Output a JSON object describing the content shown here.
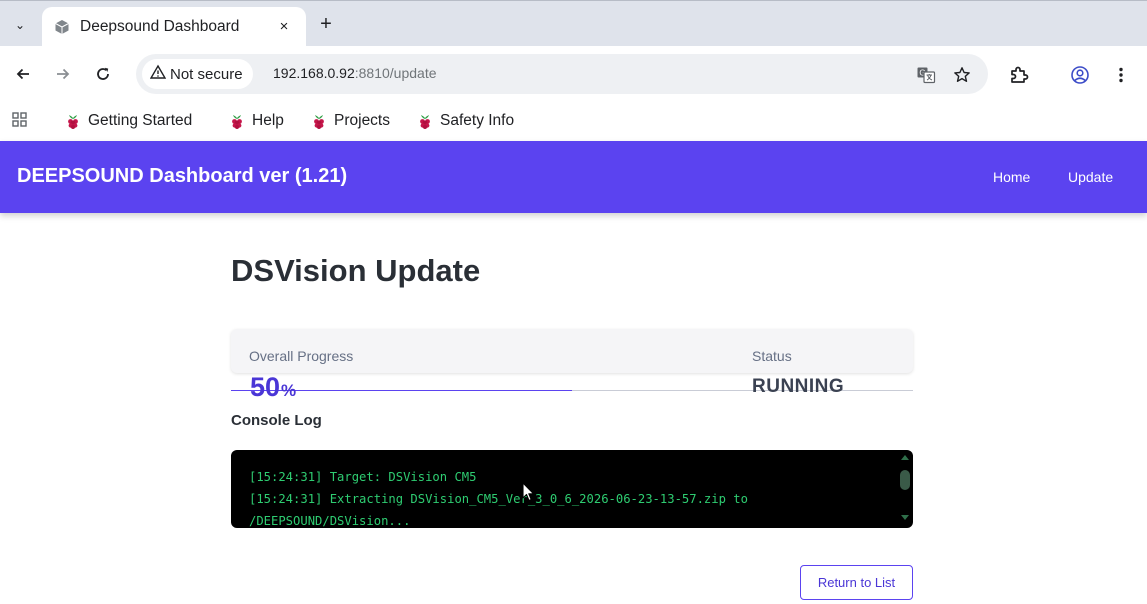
{
  "browser": {
    "tab": {
      "title": "Deepsound Dashboard",
      "close_glyph": "×",
      "favicon": "cube-icon"
    },
    "new_tab_glyph": "+",
    "tab_menu_glyph": "⌄",
    "security_label": "Not secure",
    "url_host": "192.168.0.92",
    "url_rest": ":8810/update",
    "bookmarks": [
      {
        "label": "Getting Started",
        "icon": "raspberry-icon"
      },
      {
        "label": "Help",
        "icon": "raspberry-icon"
      },
      {
        "label": "Projects",
        "icon": "raspberry-icon"
      },
      {
        "label": "Safety Info",
        "icon": "raspberry-icon"
      }
    ]
  },
  "app": {
    "title": "DEEPSOUND Dashboard ver (1.21)",
    "nav": {
      "home": "Home",
      "update": "Update"
    },
    "accent_color": "#5b43f0"
  },
  "page": {
    "title": "DSVision Update",
    "progress": {
      "label": "Overall Progress",
      "value": "50",
      "unit": "%",
      "fraction": 0.5
    },
    "status": {
      "label": "Status",
      "value": "RUNNING"
    },
    "console": {
      "label": "Console Log",
      "lines": [
        "[15:24:31] Target: DSVision CM5",
        "[15:24:31] Extracting DSVision_CM5_Ver_3_0_6_2026-06-23-13-57.zip to",
        "/DEEPSOUND/DSVision..."
      ]
    },
    "return_button": "Return to List"
  }
}
